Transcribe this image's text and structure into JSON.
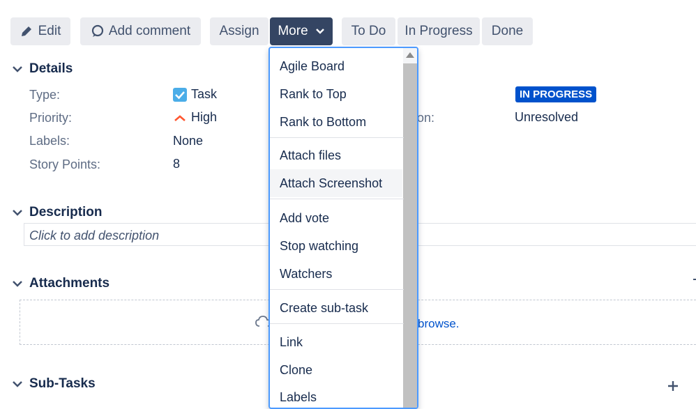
{
  "toolbar": {
    "edit": "Edit",
    "add_comment": "Add comment",
    "assign": "Assign",
    "more": "More",
    "todo": "To Do",
    "in_progress": "In Progress",
    "done": "Done"
  },
  "details": {
    "heading": "Details",
    "type_label": "Type:",
    "type_value": "Task",
    "priority_label": "Priority:",
    "priority_value": "High",
    "labels_label": "Labels:",
    "labels_value": "None",
    "story_points_label": "Story Points:",
    "story_points_value": "8",
    "status_value": "IN PROGRESS",
    "resolution_label_fragment": "on:",
    "resolution_value": "Unresolved"
  },
  "description": {
    "heading": "Description",
    "placeholder": "Click to add description"
  },
  "attachments": {
    "heading": "Attachments",
    "browse_fragment": "browse."
  },
  "subtasks": {
    "heading": "Sub-Tasks"
  },
  "more_menu": {
    "items": [
      "Agile Board",
      "Rank to Top",
      "Rank to Bottom",
      "Attach files",
      "Attach Screenshot",
      "Add vote",
      "Stop watching",
      "Watchers",
      "Create sub-task",
      "Link",
      "Clone",
      "Labels"
    ]
  },
  "colors": {
    "accent_blue": "#0052cc",
    "priority_high": "#ff5630",
    "button_bg": "#ebecf0",
    "more_button_bg": "#344563"
  }
}
